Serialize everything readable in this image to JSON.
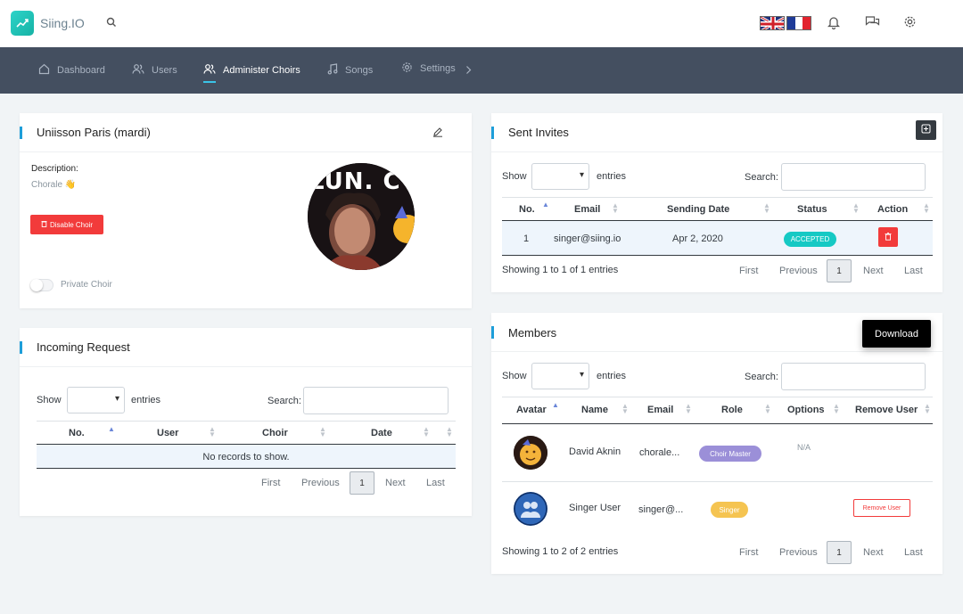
{
  "app": {
    "name": "Siing.IO"
  },
  "header": {
    "flags": [
      "uk-flag",
      "fr-flag"
    ]
  },
  "nav": {
    "items": [
      {
        "label": "Dashboard",
        "icon": "home-icon"
      },
      {
        "label": "Users",
        "icon": "users-icon"
      },
      {
        "label": "Administer Choirs",
        "icon": "users-icon",
        "active": true
      },
      {
        "label": "Songs",
        "icon": "music-icon"
      },
      {
        "label": "Settings",
        "icon": "gear-icon"
      }
    ]
  },
  "choir": {
    "title": "Uniisson Paris (mardi)",
    "description_label": "Description:",
    "description_value": "Chorale 👋",
    "disable_label": "Disable Choir",
    "private_label": "Private Choir",
    "image_text": "LUN. C"
  },
  "incoming": {
    "title": "Incoming Request",
    "show": "Show",
    "entries": "entries",
    "search": "Search:",
    "columns": [
      "No.",
      "User",
      "Choir",
      "Date"
    ],
    "empty": "No records to show.",
    "pagination": {
      "first": "First",
      "previous": "Previous",
      "current": "1",
      "next": "Next",
      "last": "Last"
    }
  },
  "invites": {
    "title": "Sent Invites",
    "show": "Show",
    "entries": "entries",
    "search": "Search:",
    "columns": [
      "No.",
      "Email",
      "Sending Date",
      "Status",
      "Action"
    ],
    "rows": [
      {
        "no": "1",
        "email": "singer@siing.io",
        "date": "Apr 2, 2020",
        "status": "ACCEPTED"
      }
    ],
    "info": "Showing 1 to 1 of 1 entries",
    "pagination": {
      "first": "First",
      "previous": "Previous",
      "current": "1",
      "next": "Next",
      "last": "Last"
    }
  },
  "members": {
    "title": "Members",
    "download": "Download",
    "show": "Show",
    "entries": "entries",
    "search": "Search:",
    "columns": [
      "Avatar",
      "Name",
      "Email",
      "Role",
      "Options",
      "Remove User"
    ],
    "rows": [
      {
        "name": "David Aknin",
        "email": "chorale...",
        "role": "Choir Master",
        "options": "N/A",
        "remove": ""
      },
      {
        "name": "Singer User",
        "email": "singer@...",
        "role": "Singer",
        "options": "",
        "remove": "Remove User"
      }
    ],
    "info": "Showing 1 to 2 of 2 entries",
    "pagination": {
      "first": "First",
      "previous": "Previous",
      "current": "1",
      "next": "Next",
      "last": "Last"
    }
  },
  "colors": {
    "accent": "#1e9ed9",
    "nav_bg": "#444f60",
    "accepted": "#16c9c4",
    "choir_master": "#9b8fd8",
    "singer": "#f5c451",
    "danger": "#f23b3b"
  }
}
